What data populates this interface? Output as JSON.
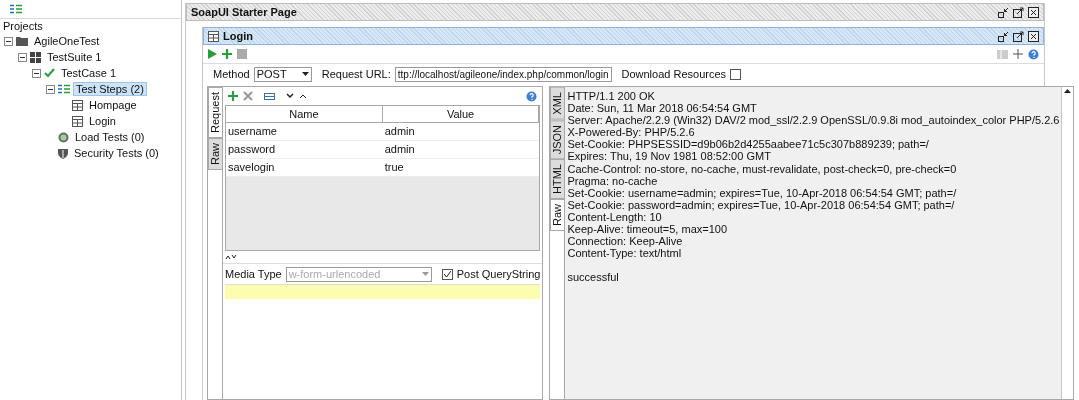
{
  "navigator": {
    "root_label": "Projects",
    "tree": [
      {
        "label": "AgileOneTest",
        "kind": "project",
        "expanded": true,
        "selected": false,
        "children": [
          {
            "label": "TestSuite 1",
            "kind": "suite",
            "expanded": true,
            "selected": false,
            "children": [
              {
                "label": "TestCase 1",
                "kind": "case",
                "expanded": true,
                "selected": false,
                "children": [
                  {
                    "label": "Test Steps (2)",
                    "kind": "steps",
                    "expanded": true,
                    "selected": true,
                    "children": [
                      {
                        "label": "Hompage",
                        "kind": "step",
                        "selected": false
                      },
                      {
                        "label": "Login",
                        "kind": "step",
                        "selected": false
                      }
                    ]
                  },
                  {
                    "label": "Load Tests (0)",
                    "kind": "load",
                    "selected": false
                  },
                  {
                    "label": "Security Tests (0)",
                    "kind": "security",
                    "selected": false
                  }
                ]
              }
            ]
          }
        ]
      }
    ]
  },
  "starter_page": {
    "title": "SoapUI Starter Page"
  },
  "request_window": {
    "title": "Login",
    "method_label": "Method",
    "method": "POST",
    "url_label": "Request URL:",
    "url": "ttp://localhost/agileone/index.php/common/login",
    "download": {
      "label": "Download Resources",
      "checked": false
    }
  },
  "request": {
    "tabs": [
      {
        "label": "Request",
        "selected": true
      },
      {
        "label": "Raw",
        "selected": false
      }
    ],
    "columns": [
      "Name",
      "Value"
    ],
    "rows": [
      [
        "username",
        "admin"
      ],
      [
        "password",
        "admin"
      ],
      [
        "savelogin",
        "true"
      ]
    ],
    "media_type_label": "Media Type",
    "media_type": "w-form-urlencoded",
    "post_querystring": {
      "label": "Post QueryString",
      "checked": true
    }
  },
  "response": {
    "tabs": [
      {
        "label": "XML",
        "selected": false
      },
      {
        "label": "JSON",
        "selected": false
      },
      {
        "label": "HTML",
        "selected": false
      },
      {
        "label": "Raw",
        "selected": true
      }
    ],
    "headers": [
      "HTTP/1.1 200 OK",
      "Date: Sun, 11 Mar 2018 06:54:54 GMT",
      "Server: Apache/2.2.9 (Win32) DAV/2 mod_ssl/2.2.9 OpenSSL/0.9.8i mod_autoindex_color PHP/5.2.6",
      "X-Powered-By: PHP/5.2.6",
      "Set-Cookie: PHPSESSID=d9b06b2d4255aabee71c5c307b889239; path=/",
      "Expires: Thu, 19 Nov 1981 08:52:00 GMT",
      "Cache-Control: no-store, no-cache, must-revalidate, post-check=0, pre-check=0",
      "Pragma: no-cache",
      "Set-Cookie: username=admin; expires=Tue, 10-Apr-2018 06:54:54 GMT; path=/",
      "Set-Cookie: password=admin; expires=Tue, 10-Apr-2018 06:54:54 GMT; path=/",
      "Content-Length: 10",
      "Keep-Alive: timeout=5, max=100",
      "Connection: Keep-Alive",
      "Content-Type: text/html"
    ],
    "body": "successful"
  }
}
